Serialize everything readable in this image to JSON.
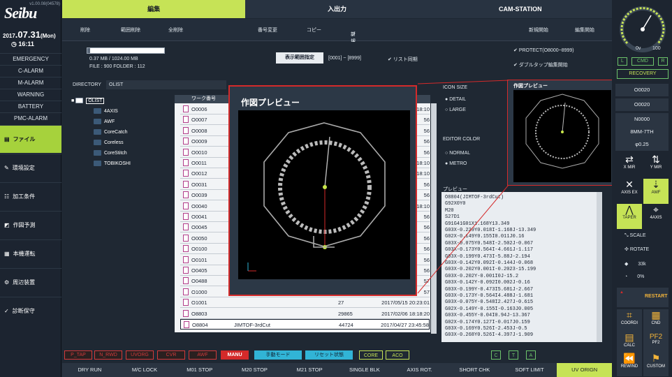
{
  "app": {
    "logo": "Seibu",
    "version": "v1.00.08(04578)",
    "date_year": "2017",
    "date_day": ".07.31",
    "date_weekday": "(Mon)",
    "time": "16:11"
  },
  "alarms": [
    "EMERGENCY",
    "C-ALARM",
    "M-ALARM",
    "WARNING",
    "BATTERY",
    "PMC-ALARM"
  ],
  "side_menu": [
    {
      "label": "ファイル",
      "active": true
    },
    {
      "label": "環境設定"
    },
    {
      "label": "加工条件"
    },
    {
      "label": "作図予測"
    },
    {
      "label": "本機運転"
    },
    {
      "label": "周辺装置"
    },
    {
      "label": "診断保守"
    }
  ],
  "tabs": [
    {
      "label": "編集",
      "active": true
    },
    {
      "label": "入出力"
    },
    {
      "label": "CAM-STATION"
    }
  ],
  "toolbar": {
    "delete": "削除",
    "range_delete": "範囲削除",
    "delete_all": "全削除",
    "rename": "番号変更",
    "copy": "コピー",
    "new_folder_1": "新規",
    "new_folder_2": "フォルダ",
    "new_start": "新規開始",
    "edit_start": "編集開始"
  },
  "memory": {
    "usage": "0.37 MB / 1024.00 MB",
    "files": "FILE : 900   FOLDER : 112"
  },
  "range": {
    "button": "表示範囲指定",
    "value": "[0001] ~ [8999]",
    "list_sync": "リスト同期"
  },
  "protect": {
    "label": "PROTECT(O8000~8999)",
    "double_tap": "ダブルタップ編集開始"
  },
  "directory": {
    "label": "DIRECTORY",
    "value": "OLIST"
  },
  "tree": {
    "root": "OLIST",
    "children": [
      "4AXIS",
      "AWF",
      "CoreCatch",
      "Coreless",
      "CoreStitch",
      "TOBIKOSHI"
    ]
  },
  "list": {
    "header": "ワーク番号",
    "rows": [
      {
        "no": "O0006",
        "name": "",
        "size": "",
        "date": "18:10"
      },
      {
        "no": "O0007",
        "name": "",
        "size": "",
        "date": "56"
      },
      {
        "no": "O0008",
        "name": "",
        "size": "",
        "date": "56"
      },
      {
        "no": "O0009",
        "name": "",
        "size": "",
        "date": "56"
      },
      {
        "no": "O0010",
        "name": "",
        "size": "",
        "date": "56"
      },
      {
        "no": "O0011",
        "name": "",
        "size": "",
        "date": "18:10"
      },
      {
        "no": "O0012",
        "name": "",
        "size": "",
        "date": "18:10"
      },
      {
        "no": "O0031",
        "name": "",
        "size": "",
        "date": "56"
      },
      {
        "no": "O0039",
        "name": "",
        "size": "",
        "date": "56"
      },
      {
        "no": "O0040",
        "name": "",
        "size": "",
        "date": "18:10"
      },
      {
        "no": "O0041",
        "name": "",
        "size": "",
        "date": "56"
      },
      {
        "no": "O0045",
        "name": "",
        "size": "",
        "date": "56"
      },
      {
        "no": "O0050",
        "name": "",
        "size": "",
        "date": "56"
      },
      {
        "no": "O0100",
        "name": "",
        "size": "",
        "date": "56"
      },
      {
        "no": "O0101",
        "name": "",
        "size": "",
        "date": "56"
      },
      {
        "no": "O0405",
        "name": "",
        "size": "",
        "date": "56"
      },
      {
        "no": "O0488",
        "name": "",
        "size": "",
        "date": "57"
      },
      {
        "no": "O1000",
        "name": "",
        "size": "",
        "date": "57"
      },
      {
        "no": "O1001",
        "name": "",
        "size": "27",
        "date": "2017/05/15 20:23:01"
      },
      {
        "no": "O8803",
        "name": "",
        "size": "29865",
        "date": "2017/02/06 18:18:20"
      },
      {
        "no": "O8804",
        "name": "JIMTOF-3rdCut",
        "size": "44724",
        "date": "2017/04/27 23:45:58"
      }
    ]
  },
  "icon_size": {
    "label": "ICON SIZE",
    "detail": "DETAIL",
    "large": "LARGE"
  },
  "editor_color": {
    "label": "EDITOR COLOR",
    "normal": "NORMAL",
    "metro": "METRO"
  },
  "preview": {
    "title_big": "作図プレビュー",
    "title_small": "作図プレビュー",
    "code_label": "プレビュー",
    "code": [
      "O8804(JIMTOF-3rdCut)",
      "G92X0Y0",
      "M20",
      "S27D1",
      "G91G41G01X1.168Y13.349",
      "G03X-0.229Y0.018I-1.168J-13.349",
      "G02X-0.149Y0.155I0.011J0.16",
      "G03X-0.075Y0.548I-2.502J-0.067",
      "G03X-0.173Y0.564I-4.661J-1.117",
      "G03X-0.199Y0.473I-5.88J-2.194",
      "G03X-0.142Y0.092I-0.144J-0.068",
      "G03X-0.202Y0.001I-0.2023-15.199",
      "G03X-0.202Y-0.001I0J-15.2",
      "G03X-0.142Y-0.092I0.002J-0.16",
      "G03X-0.199Y-0.473I5.681J-2.667",
      "G03X-0.173Y-0.564I4.488J-1.681",
      "G03X-0.075Y-0.548I2.427J-0.615",
      "G02X-0.149Y-0.155I-0.163J0.005",
      "G03X-0.455Y-0.04I0.94J-13.367",
      "G02X-0.174Y0.127I-0.017J0.159",
      "G03X-0.169Y0.526I-2.453J-0.5",
      "G03X-0.268Y0.526I-4.397J-1.909"
    ]
  },
  "status_buttons": [
    "P_TAP",
    "N_RWD",
    "UVORG",
    "CVR",
    "AWF"
  ],
  "manu": "MANU",
  "manual_mode": "手動モード",
  "reset_state": "リセット状態",
  "core": "CORE",
  "aco": "ACO",
  "cta": [
    "C",
    "T",
    "A"
  ],
  "bottom": [
    {
      "label": "DRY RUN"
    },
    {
      "label": "M/C LOCK"
    },
    {
      "label": "M01 STOP"
    },
    {
      "label": "M20 STOP"
    },
    {
      "label": "M21 STOP"
    },
    {
      "label": "SINGLE BLK"
    },
    {
      "label": "AXIS ROT."
    },
    {
      "label": "SHORT CHK"
    },
    {
      "label": "SOFT LIMIT"
    },
    {
      "label": "UV ORIGN",
      "active": true
    }
  ],
  "right": {
    "gauge_zero": "0v",
    "gauge_max": "100",
    "l": "L",
    "cmd": "CMD",
    "r": "R",
    "recovery": "RECOVERY",
    "o1": "O0020",
    "o2": "O0020",
    "n": "N0000",
    "tool": "8MM-7TH",
    "phi": "φ0.25",
    "xmir": "X MIR",
    "ymir": "Y MIR",
    "axisex": "AXIS EX",
    "awf": "AWF",
    "taper": "TAPER",
    "axis4": "4AXIS",
    "scale": "SCALE",
    "rotate": "ROTATE",
    "val33": "33k",
    "val0": "0%",
    "restart": "RESTART",
    "coord": "COORDI",
    "cnd": "CND",
    "calc": "CALC",
    "pf2": "PF2",
    "rewind": "REWIND",
    "custom": "CUSTOM"
  },
  "colors": {
    "accent": "#c6e356",
    "red": "#d42a2a",
    "cyan": "#31b4d6"
  }
}
